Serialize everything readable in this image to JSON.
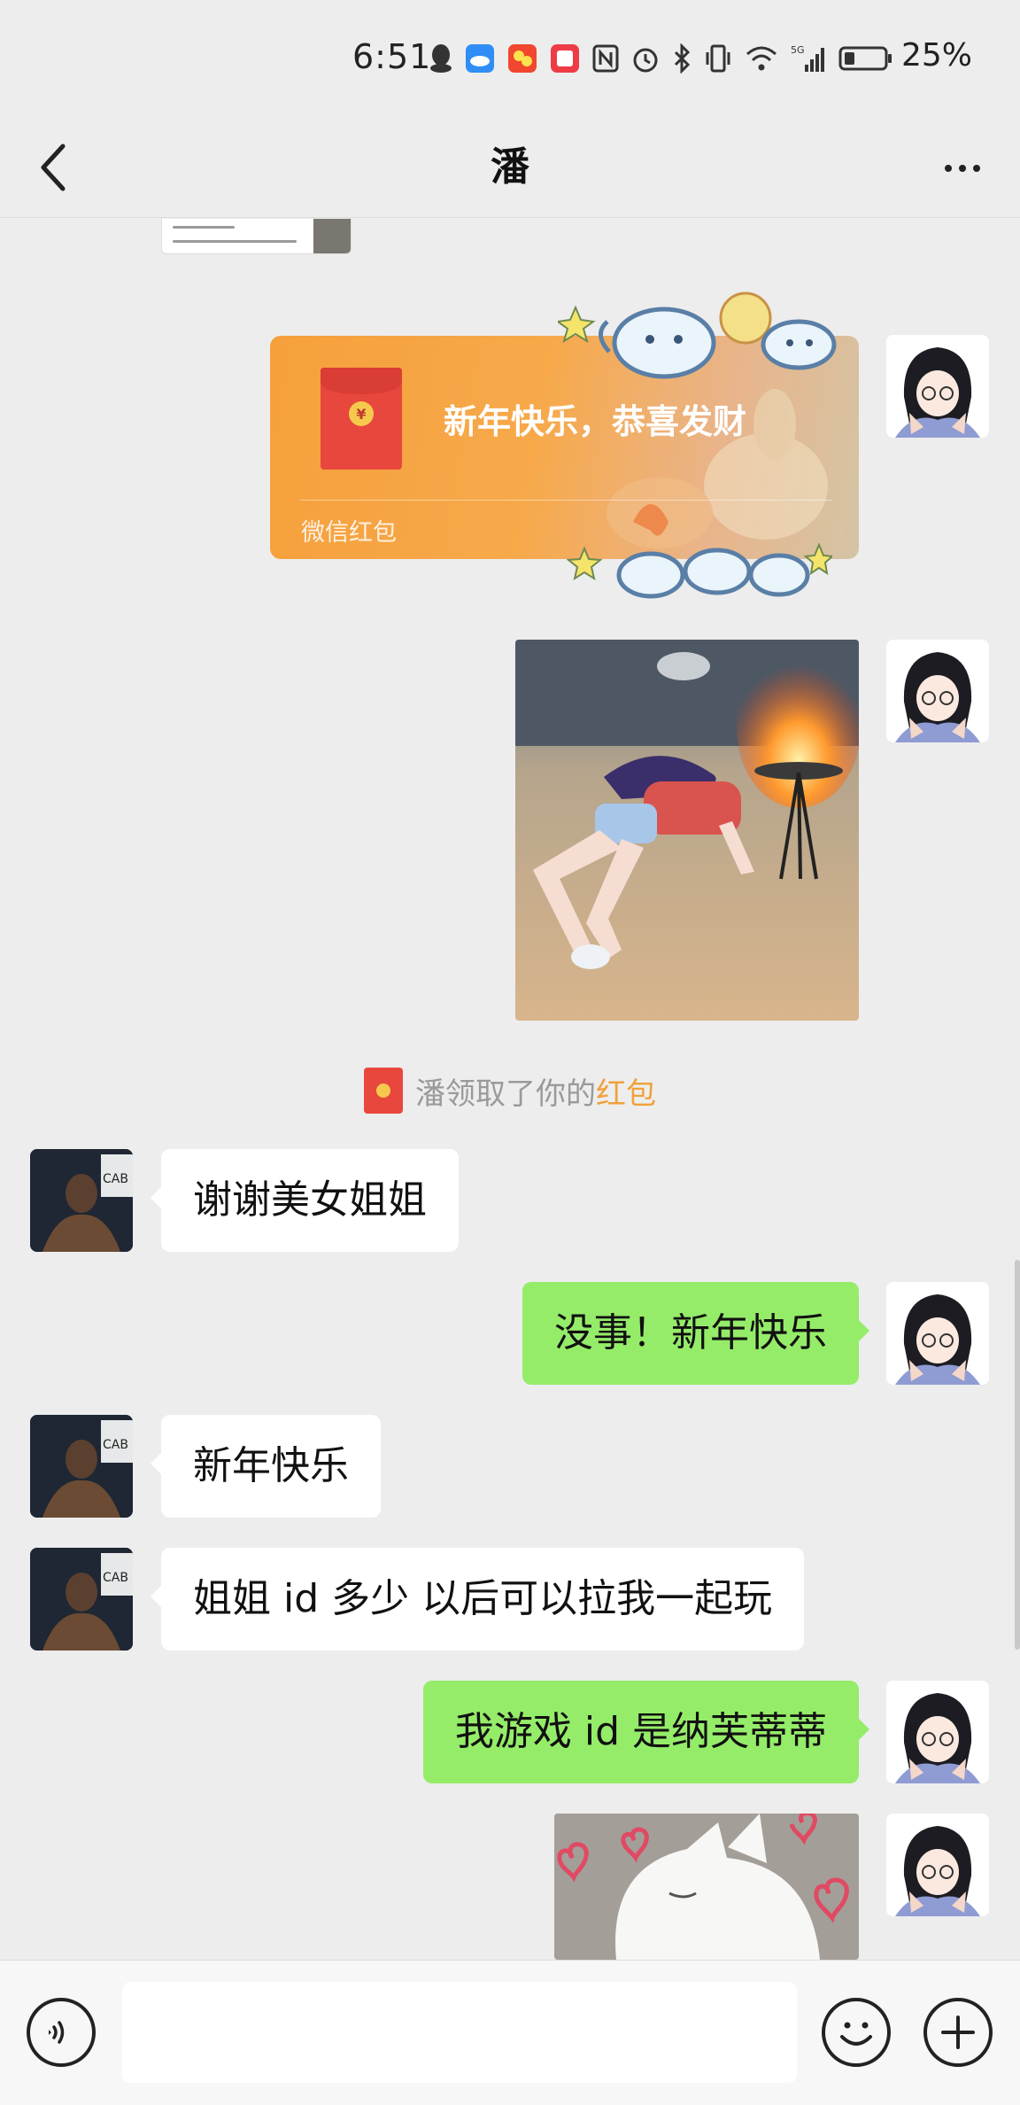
{
  "status_bar": {
    "time": "6:51",
    "network": "5G",
    "battery_percent": "25%",
    "battery_level": 0.25
  },
  "nav": {
    "title": "潘"
  },
  "messages": {
    "red_packet": {
      "title": "新年快乐，恭喜发财",
      "footer": "微信红包",
      "coin_symbol": "¥"
    },
    "system_notice": {
      "text": "潘领取了你的",
      "link": "红包"
    },
    "m1": "谢谢美女姐姐",
    "m2": "没事！新年快乐",
    "m3": "新年快乐",
    "m4": "姐姐 id 多少 以后可以拉我一起玩",
    "m5": "我游戏 id 是纳芙蒂蒂"
  },
  "input_bar": {
    "placeholder": ""
  },
  "colors": {
    "background": "#ededed",
    "bubble_self": "#95ec69",
    "bubble_other": "#ffffff",
    "red_packet": "#f5a03c",
    "red_packet_link": "#f0a13c"
  },
  "icons": [
    "back-arrow-icon",
    "more-icon",
    "voice-icon",
    "emoji-icon",
    "plus-icon",
    "red-packet-icon"
  ]
}
